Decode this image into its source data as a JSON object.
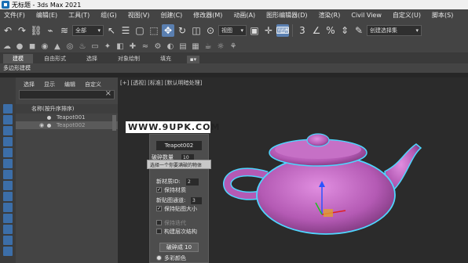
{
  "window": {
    "title": "无标题 - 3ds Max 2021"
  },
  "menu": [
    "文件(F)",
    "编辑(E)",
    "工具(T)",
    "组(G)",
    "视图(V)",
    "创建(C)",
    "修改器(M)",
    "动画(A)",
    "图形编辑器(D)",
    "渲染(R)",
    "Civil View",
    "自定义(U)",
    "脚本(S)"
  ],
  "toolbar": {
    "selection_filter": "全部",
    "view_dropdown": "视图",
    "named_selection": "创建选择集"
  },
  "ribbon": {
    "tabs": [
      "建模",
      "自由形式",
      "选择",
      "对象绘制",
      "填充"
    ],
    "subtab": "多边形建模"
  },
  "explorer": {
    "menu": [
      "选择",
      "显示",
      "编辑",
      "自定义"
    ],
    "column_header": "名称(按升序排序)",
    "items": [
      "Teapot001",
      "Teapot002"
    ]
  },
  "viewport": {
    "label": "[+] [透视] [标准] [默认明暗处理]"
  },
  "dialog": {
    "name_field": "Teapot002",
    "count_label": "破碎数量",
    "count_value": "10",
    "tooltip": "选择一个你要满破的物体",
    "new_mat_id_label": "新材质ID:",
    "new_mat_id_value": "2",
    "keep_material": "保持材质",
    "new_map_channel_label": "新贴图通道:",
    "new_map_channel_value": "3",
    "keep_map_size": "保持贴图大小",
    "keep_iterations": "保持迭代",
    "build_hierarchy": "构建层次结构",
    "fracture_button": "破碎成 10",
    "multi_color": "多彩颜色"
  },
  "watermark": "WWW.9UPK.COM",
  "colors": {
    "teapot": "#c064c0",
    "selection_outline": "#4fd6ff",
    "accent": "#5a7fb0"
  }
}
